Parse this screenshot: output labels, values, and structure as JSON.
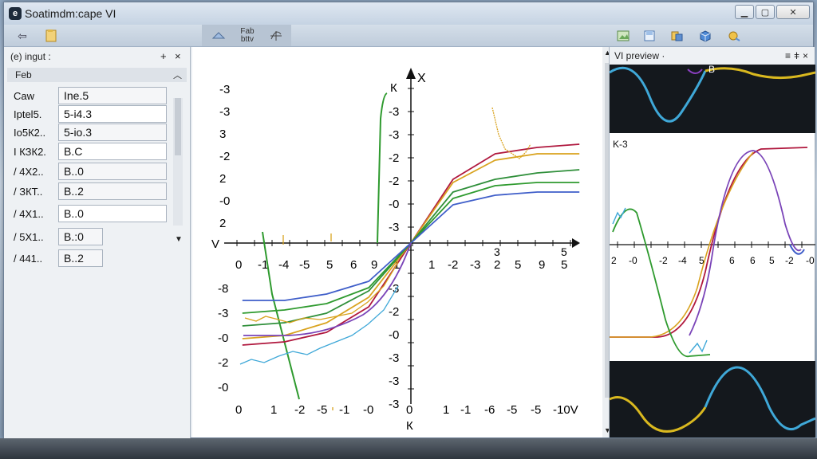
{
  "window": {
    "title": "Soatimdm:cape VI",
    "icon_letter": "e",
    "min_icon": "minimize-icon",
    "max_icon": "maximize-icon",
    "close_icon": "close-icon"
  },
  "toolbar": {
    "left_buttons": [
      "back-icon",
      "document-icon"
    ],
    "mid_label_1": "Fab",
    "mid_label_2": "bttv",
    "right_icons": [
      "image-icon",
      "save-icon",
      "bookmark-icon",
      "cube-icon",
      "settings-icon"
    ]
  },
  "input_panel": {
    "title": "(e) ingut :",
    "add_glyph": "+",
    "close_glyph": "×",
    "section_label": "Feb",
    "rows": [
      {
        "label": "Cаw",
        "value": "Ine.5"
      },
      {
        "label": "Iptel5.",
        "value": "5-i4.3"
      },
      {
        "label": "Io5К2..",
        "value": "5-io.3"
      },
      {
        "label": "I КЗК2.",
        "value": "B.C"
      },
      {
        "label": "/ 4X2..",
        "value": "B..0"
      },
      {
        "label": "/ ЗКТ..",
        "value": "B..2"
      },
      {
        "label": "/ 4X1..",
        "value": "B..0"
      },
      {
        "label": "/ 5X1..",
        "value": "B.:0"
      },
      {
        "label": "/ 441..",
        "value": "B..2"
      }
    ]
  },
  "main_chart": {
    "x_axis_label": "X",
    "y_axis_label": "К",
    "y_side_label": "V",
    "bottom_label": "К",
    "top_y_tick_label": "К",
    "left_y_ticks": [
      "-3",
      "-3",
      "3",
      "-2",
      "2",
      "-0",
      "2"
    ],
    "left_y_ticks_lower": [
      "-8",
      "-3",
      "-0",
      "-2",
      "-0"
    ],
    "axis_y_ticks_upper": [
      "-3",
      "-3",
      "-2",
      "-2",
      "-0",
      "-3"
    ],
    "axis_y_ticks_lower": [
      "-3",
      "-2",
      "-0",
      "-3",
      "-3",
      "-3"
    ],
    "x_ticks_row1": [
      "0",
      "-1",
      "-4",
      "-5",
      "5",
      "6",
      "9",
      "1",
      "1",
      "-2",
      "-3",
      "2",
      "5",
      "9",
      "5"
    ],
    "x_ticks_row1_extra": [
      "3",
      "5"
    ],
    "x_ticks_row2": [
      "0",
      "1",
      "-2",
      "-5",
      "-1",
      "-0",
      "0",
      "1",
      "-1",
      "-6",
      "-5",
      "-5",
      "-10V"
    ],
    "x_ticks_right_sup": [
      "3",
      "5"
    ],
    "colors": {
      "red": "#b0183e",
      "orange": "#d9a31f",
      "green": "#2e9a2e",
      "dark_green": "#2f8f3a",
      "blue": "#3f5ec9",
      "purple": "#7a44b8",
      "cyan": "#3fa8d8"
    }
  },
  "chart_data": {
    "type": "line",
    "title": "",
    "xlabel": "X",
    "ylabel": "К",
    "series": [
      {
        "values": [
          -3.2,
          -3.1,
          -2.8,
          -2.0,
          0,
          2.0,
          2.8,
          3.0,
          3.1
        ]
      },
      {
        "values": [
          -3.0,
          -2.9,
          -2.5,
          -1.7,
          0,
          1.9,
          2.6,
          2.8,
          2.8
        ]
      },
      {
        "values": [
          -2.6,
          -2.5,
          -2.2,
          -1.5,
          0,
          1.6,
          2.0,
          2.2,
          2.3
        ]
      },
      {
        "values": [
          -2.2,
          -2.1,
          -1.9,
          -1.4,
          0,
          1.4,
          1.8,
          1.9,
          1.9
        ]
      },
      {
        "values": [
          -1.8,
          -1.8,
          -1.6,
          -1.2,
          0,
          1.2,
          1.5,
          1.6,
          1.6
        ]
      }
    ],
    "x": [
      -8,
      -6,
      -4,
      -2,
      0,
      2,
      4,
      6,
      8
    ],
    "grid": false
  },
  "preview": {
    "title": "VI preview ·",
    "pin_glyph": "≡",
    "dock_glyph": "ǂ",
    "close_glyph": "×",
    "top_label": "B",
    "mid_label": "K-3",
    "x_ticks": [
      "2",
      "-0",
      "-2",
      "-4",
      "5",
      "6",
      "6",
      "5",
      "-2",
      "-0"
    ]
  }
}
